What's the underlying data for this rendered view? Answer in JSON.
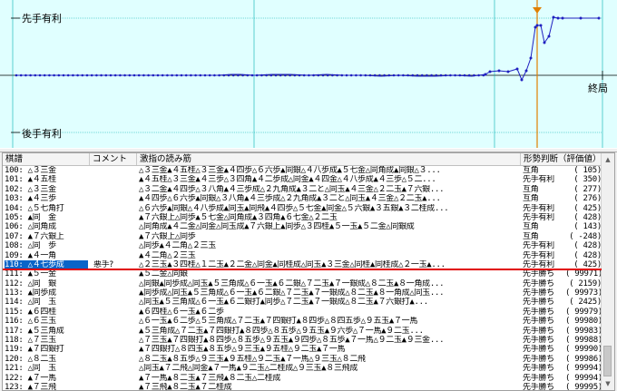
{
  "graph": {
    "top_label": "先手有利",
    "bottom_label": "後手有利",
    "end_label": "終局"
  },
  "list": {
    "headers": {
      "move": "棋譜",
      "comment": "コメント",
      "reading": "激指の読み筋",
      "judge": "形勢判断（評価値）"
    },
    "rows": [
      {
        "move": "100: △３三金",
        "comment": "",
        "reading": "△３三金▲４五桂△３三金▲４四歩△６六歩▲同銀△４八歩成▲５七金△同角成▲同銀△３...",
        "judge": "互角",
        "value": "(   105)"
      },
      {
        "move": "101: ▲４五桂",
        "comment": "",
        "reading": "▲４五桂△３三金▲４三歩△３四角▲４二歩成△同金▲４四金△４八歩成▲４三歩△５二...",
        "judge": "先手有利",
        "value": "(   350)"
      },
      {
        "move": "102: △３三金",
        "comment": "",
        "reading": "△３二金▲４四歩△３八角▲４三歩成△２九角成▲３二と△同玉▲４三金△２二玉▲７六銀...",
        "judge": "互角",
        "value": "(   277)"
      },
      {
        "move": "103: ▲４三歩",
        "comment": "",
        "reading": "▲４四歩△６六歩▲同銀△３八角▲４三歩成△２九角成▲３二と△同玉▲４三金△２二玉▲...",
        "judge": "互角",
        "value": "(   276)"
      },
      {
        "move": "104: △５七角打",
        "comment": "",
        "reading": "△６六歩▲同銀△４八歩成▲同玉▲同飛▲４四歩△５七金▲同金△５六銀▲３五銀▲３二桂成...",
        "judge": "先手有利",
        "value": "(   425)"
      },
      {
        "move": "105: ▲同　金",
        "comment": "",
        "reading": "▲７六銀上△同歩▲５七金△同角成▲３四角▲６七金△２二玉",
        "judge": "先手有利",
        "value": "(   428)"
      },
      {
        "move": "106: △同角成",
        "comment": "",
        "reading": "△同角成▲４二金△同金△同玉成▲７六銀上▲同歩△３四桂▲５一玉▲５二金△同銀成",
        "judge": "互角",
        "value": "(   143)"
      },
      {
        "move": "107: ▲７六銀上",
        "comment": "",
        "reading": "▲７六銀上△同歩",
        "judge": "互角",
        "value": "(  -248)"
      },
      {
        "move": "108: △同　歩",
        "comment": "",
        "reading": "△同歩▲４二角△２三玉",
        "judge": "先手有利",
        "value": "(   428)"
      },
      {
        "move": "109: ▲４一角",
        "comment": "",
        "reading": "▲４二角△２三玉",
        "judge": "先手有利",
        "value": "(   428)"
      },
      {
        "move": "110: △４七歩成",
        "comment": "悪手?",
        "reading": "△２三玉▲３四桂△１二玉▲２二金△同金▲同桂成△同玉▲３三金△同桂▲同桂成△２一玉▲...",
        "judge": "先手有利",
        "value": "(   425)"
      },
      {
        "move": "111: ▲５一金",
        "comment": "",
        "reading": "▲５二金△同銀",
        "judge": "先手勝ち",
        "value": "( 99971)"
      },
      {
        "move": "112: △同　銀",
        "comment": "",
        "reading": "△同銀▲同歩成△同玉▲５三角成△６一玉▲６二銀△７二玉▲７一銀成△８二玉▲８一角成...",
        "judge": "先手勝ち",
        "value": "(  2159)"
      },
      {
        "move": "113: ▲同歩成",
        "comment": "",
        "reading": "▲同歩成△同玉▲５三角成△６一玉▲６二銀△７二玉▲７一銀成△８二玉▲８一角成△同玉...",
        "judge": "先手勝ち",
        "value": "( 99973)"
      },
      {
        "move": "114: △同　玉",
        "comment": "",
        "reading": "△同玉▲５三角成△６一玉▲６二銀打▲同歩△７二玉▲７一銀成△８二玉▲７六銀打▲...",
        "judge": "先手勝ち",
        "value": "(  2425)"
      },
      {
        "move": "115: ▲６四桂",
        "comment": "",
        "reading": "▲６四桂△６一玉▲６二歩",
        "judge": "先手勝ち",
        "value": "( 99979)"
      },
      {
        "move": "116: △６三玉",
        "comment": "",
        "reading": "△６一玉▲６二歩△５三角成△７二玉▲７四銀打▲８四歩△８四五歩△９五玉▲７一馬",
        "judge": "先手勝ち",
        "value": "( 99980)"
      },
      {
        "move": "117: ▲５三角成",
        "comment": "",
        "reading": "▲５三角成△７二玉▲７四銀打▲８四歩△８五歩△９五玉▲９六歩△７一馬▲９二玉...",
        "judge": "先手勝ち",
        "value": "( 99983)"
      },
      {
        "move": "118: △７三玉",
        "comment": "",
        "reading": "△７三玉▲７四銀打▲８四歩△８五歩△９五玉▲９四歩△８五歩▲７一馬△９二玉▲９三金...",
        "judge": "先手勝ち",
        "value": "( 99988)"
      },
      {
        "move": "119: ▲７四銀打",
        "comment": "",
        "reading": "▲７四銀打△８四玉▲８五歩△９三玉▲９五桂△９二玉▲７一馬",
        "judge": "先手勝ち",
        "value": "( 99990)"
      },
      {
        "move": "120: △８二玉",
        "comment": "",
        "reading": "△８二玉▲８五歩△９三玉▲９五桂△９二玉▲７一馬△９三玉△８二飛",
        "judge": "先手勝ち",
        "value": "( 99986)"
      },
      {
        "move": "121: △同　玉",
        "comment": "",
        "reading": "△同玉▲７二飛△同金▲７一馬▲９二玉△二桂成△９三玉▲８三飛成",
        "judge": "先手勝ち",
        "value": "( 99994)"
      },
      {
        "move": "122: ▲７一馬",
        "comment": "",
        "reading": "▲７一馬▲８二玉▲７三飛▲８二玉△二桂成",
        "judge": "先手勝ち",
        "value": "( 99994)"
      },
      {
        "move": "123: ▲７三飛",
        "comment": "",
        "reading": "▲７三飛▲８二玉▲７二桂成",
        "judge": "先手勝ち",
        "value": "( 99995)"
      }
    ]
  },
  "colors": {
    "accent": "#0a64c8",
    "line": "#e00000",
    "graph_bg": "#e0ffff",
    "graph_line": "#2020c0",
    "grid": "#00b0b0"
  },
  "scrollbar": {
    "up_icon": "triangle-up",
    "down_icon": "triangle-down"
  }
}
